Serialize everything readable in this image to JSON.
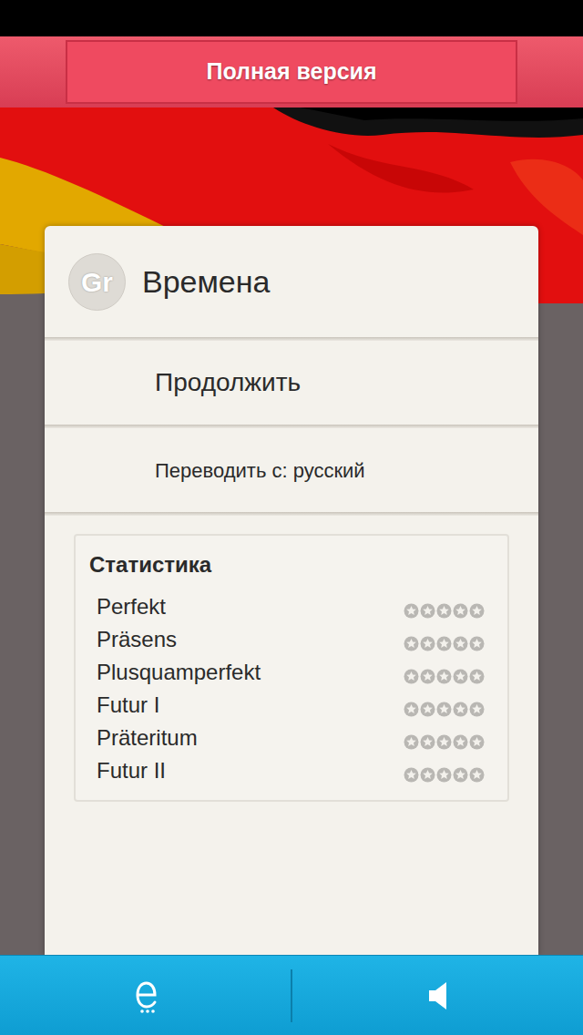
{
  "header": {
    "button": "Полная версия"
  },
  "card": {
    "badge": "Gr",
    "title": "Времена"
  },
  "menu": [
    {
      "label": "Продолжить",
      "kind": "primary"
    },
    {
      "label": "Переводить с: русский",
      "kind": "setting"
    }
  ],
  "statistics": {
    "title": "Статистика",
    "items": [
      {
        "name": "Perfekt",
        "stars": 0
      },
      {
        "name": "Präsens",
        "stars": 0
      },
      {
        "name": "Plusquamperfekt",
        "stars": 0
      },
      {
        "name": "Futur I",
        "stars": 0
      },
      {
        "name": "Präteritum",
        "stars": 0
      },
      {
        "name": "Futur II",
        "stars": 0
      }
    ]
  }
}
